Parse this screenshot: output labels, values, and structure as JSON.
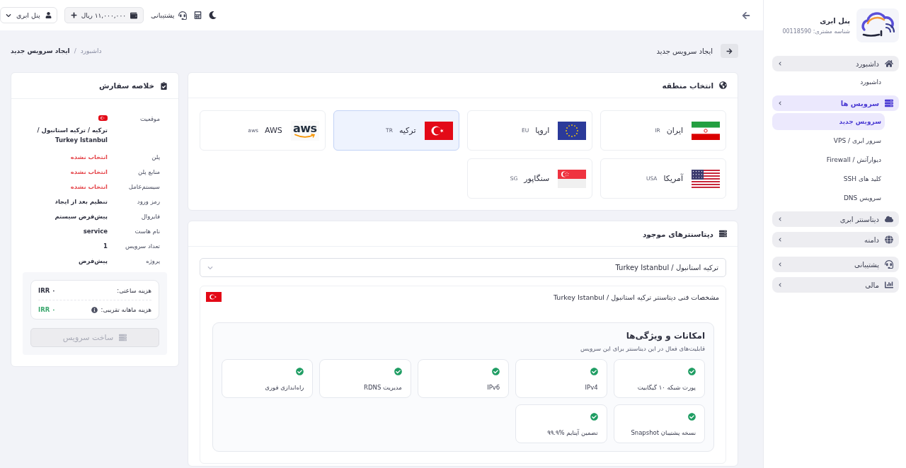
{
  "topbar": {
    "user_menu": {
      "label": "پنل ابری"
    },
    "wallet": {
      "balance": "۱۱,۰۰۰,۰۰۰ ریال"
    },
    "support": {
      "label": "پشتیبانی"
    }
  },
  "sidebar": {
    "title": "پنل ابری",
    "customer_id": "شناسه مشتری: 00118590",
    "items": [
      {
        "label": "داشبورد",
        "selected": false,
        "children": [
          {
            "label": "داشبورد",
            "selected": false
          }
        ]
      },
      {
        "label": "سرویس ها",
        "selected": true,
        "children": [
          {
            "label": "سرویس جدید",
            "selected": true
          },
          {
            "label": "سرور ابری / VPS",
            "selected": false
          },
          {
            "label": "دیوارآتش / Firewall",
            "selected": false
          },
          {
            "label": "کلید های SSH",
            "selected": false
          },
          {
            "label": "سرویس DNS",
            "selected": false
          }
        ]
      },
      {
        "label": "دیتاسنتر ابری",
        "selected": false
      },
      {
        "label": "دامنه",
        "selected": false
      },
      {
        "label": "پشتیبانی",
        "selected": false
      },
      {
        "label": "مالی",
        "selected": false
      }
    ]
  },
  "page": {
    "title": "ایجاد سرویس جدید",
    "breadcrumb": {
      "separator": "/",
      "items": [
        {
          "label": "داشبورد",
          "current": false
        },
        {
          "label": "ایجاد سرویس جدید",
          "current": true
        }
      ]
    }
  },
  "regions": {
    "title": "انتخاب منطقه",
    "items": [
      {
        "name": "ایران",
        "code": "IR",
        "selected": false
      },
      {
        "name": "اروپا",
        "code": "EU",
        "selected": false
      },
      {
        "name": "ترکیه",
        "code": "TR",
        "selected": true
      },
      {
        "name": "AWS",
        "code": "aws",
        "logo_text": "aws",
        "selected": false
      },
      {
        "name": "آمریکا",
        "code": "USA",
        "selected": false
      },
      {
        "name": "سنگاپور",
        "code": "SG",
        "selected": false
      }
    ]
  },
  "datacenters": {
    "title": "دیتاسنترهای موجود",
    "select": {
      "value": "ترکیه استانبول / Turkey Istanbul"
    },
    "details": {
      "title": "مشخصات فنی دیتاسنتر ترکیه استانبول / Turkey Istanbul",
      "features": {
        "title": "امکانات و ویژگی‌ها",
        "subtitle": "قابلیت‌های فعال در این دیتاسنتر برای این سرویس",
        "items": [
          {
            "label": "پورت شبکه ۱۰ گیگابیت",
            "enabled": true
          },
          {
            "label": "IPv4",
            "enabled": true
          },
          {
            "label": "IPv6",
            "enabled": true
          },
          {
            "label": "مدیریت RDNS",
            "enabled": true
          },
          {
            "label": "راه‌اندازی فوری",
            "enabled": true
          },
          {
            "label": "نسخه پشتیبان Snapshot",
            "enabled": true
          },
          {
            "label": "تضمین آپتایم %۹۹.۹",
            "enabled": true
          }
        ]
      }
    }
  },
  "order_summary": {
    "title": "خلاصه سفارش",
    "rows": [
      {
        "kind": "location",
        "label": "موقعیت",
        "value": "ترکیه / ترکیه استانبول / Turkey Istanbul",
        "unset": false
      },
      {
        "kind": "text",
        "label": "پلن",
        "value": "انتخاب نشده",
        "unset": true
      },
      {
        "kind": "text",
        "label": "منابع پلن",
        "value": "انتخاب نشده",
        "unset": true
      },
      {
        "kind": "text",
        "label": "سیستم‌عامل",
        "value": "انتخاب نشده",
        "unset": true
      },
      {
        "kind": "text",
        "label": "رمز ورود",
        "value": "تنظیم بعد از ایجاد",
        "unset": false
      },
      {
        "kind": "text",
        "label": "فایروال",
        "value": "پیش‌فرض سیستم",
        "unset": false
      },
      {
        "kind": "text",
        "label": "نام هاست",
        "value": "service",
        "unset": false
      },
      {
        "kind": "text",
        "label": "تعداد سرویس",
        "value": "1",
        "unset": false
      },
      {
        "kind": "text",
        "label": "پروژه",
        "value": "پیش‌فرض",
        "unset": false
      }
    ],
    "costs": [
      {
        "label": "هزینه ساعتی:",
        "value": "IRR ۰",
        "info": false,
        "highlight": false
      },
      {
        "label": "هزینه ماهانه تقریبی:",
        "value": "IRR ۰",
        "info": true,
        "highlight": true
      }
    ],
    "button": {
      "label": "ساخت سرویس",
      "disabled": true
    }
  }
}
